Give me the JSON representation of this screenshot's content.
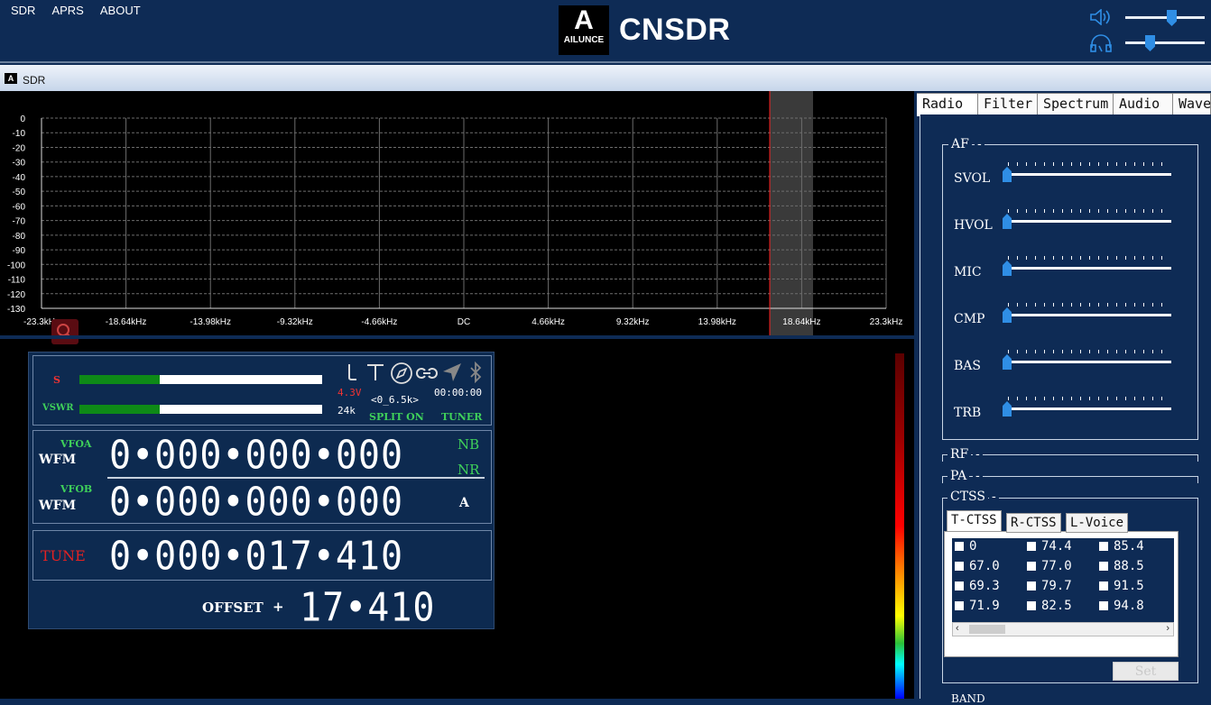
{
  "menu": [
    "SDR",
    "APRS",
    "ABOUT"
  ],
  "logo": {
    "mark": "A",
    "brand": "AILUNCE"
  },
  "app_title": "CNSDR",
  "subwindow": {
    "icon_text": "A",
    "title": "SDR"
  },
  "volume": {
    "speaker_level": 0.6,
    "headphone_level": 0.32
  },
  "spectrum": {
    "y_ticks": [
      "0",
      "-10",
      "-20",
      "-30",
      "-40",
      "-50",
      "-60",
      "-70",
      "-80",
      "-90",
      "-100",
      "-110",
      "-120",
      "-130"
    ],
    "x_ticks": [
      "-23.3kHz",
      "-18.64kHz",
      "-13.98kHz",
      "-9.32kHz",
      "-4.66kHz",
      "DC",
      "4.66kHz",
      "9.32kHz",
      "13.98kHz",
      "18.64kHz",
      "23.3kHz"
    ],
    "grid_color": "#6d6d6d",
    "marker_color": "#ff2020"
  },
  "radio": {
    "s_label": "S",
    "vswr_label": "VSWR",
    "s_level": 0.33,
    "vswr_level": 0.33,
    "voltage": "4.3V",
    "bandwidth": "24k",
    "filter": "<0_6.5k>",
    "time": "00:00:00",
    "split": "SPLIT ON",
    "tuner": "TUNER",
    "vfoa_label": "VFOA",
    "vfoa_mode": "WFM",
    "vfoa_freq": "0•000•000•000",
    "nb": "NB",
    "nr": "NR",
    "vfob_label": "VFOB",
    "vfob_mode": "WFM",
    "vfob_freq": "0•000•000•000",
    "vfo_sel": "A",
    "tune_label": "TUNE",
    "tune_freq": "0•000•017•410",
    "offset_label": "OFFSET",
    "offset_sign": "+",
    "offset_value": "17•410"
  },
  "tabs": [
    "Radio",
    "Filter",
    "Spectrum",
    "Audio",
    "Wave"
  ],
  "af": {
    "label": "AF",
    "sliders": [
      {
        "label": "SVOL",
        "value": 0
      },
      {
        "label": "HVOL",
        "value": 0
      },
      {
        "label": "MIC",
        "value": 0
      },
      {
        "label": "CMP",
        "value": 0
      },
      {
        "label": "BAS",
        "value": 0
      },
      {
        "label": "TRB",
        "value": 0
      }
    ]
  },
  "rf_label": "RF",
  "pa_label": "PA",
  "ctss": {
    "label": "CTSS",
    "tabs": [
      "T-CTSS",
      "R-CTSS",
      "L-Voice"
    ],
    "tones": [
      [
        "0",
        "74.4",
        "85.4"
      ],
      [
        "67.0",
        "77.0",
        "88.5"
      ],
      [
        "69.3",
        "79.7",
        "91.5"
      ],
      [
        "71.9",
        "82.5",
        "94.8"
      ]
    ],
    "set_label": "Set"
  },
  "band_label": "BAND"
}
